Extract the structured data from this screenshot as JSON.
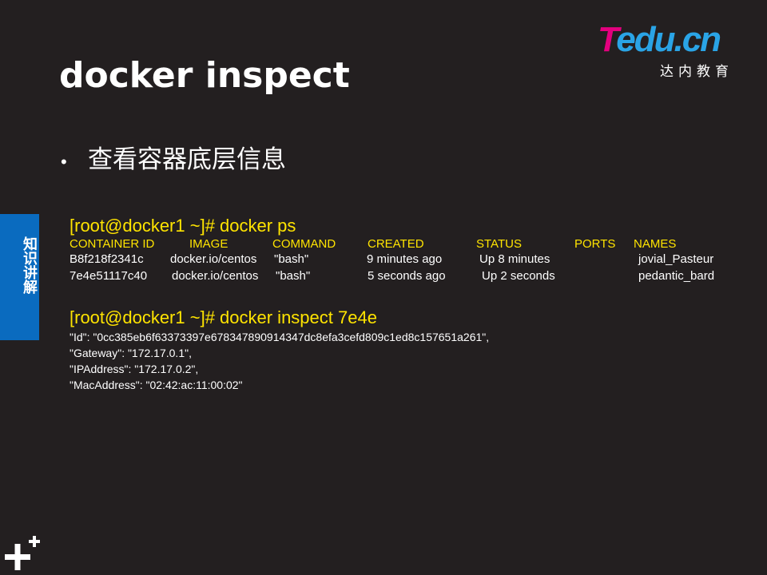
{
  "logo": {
    "word_first": "T",
    "word_rest": "edu.cn",
    "subtitle": "达内教育"
  },
  "title": "docker inspect",
  "bullet": {
    "text": "查看容器底层信息"
  },
  "side_tab": {
    "label": "知识讲解"
  },
  "terminal": {
    "cmd1": "[root@docker1 ~]# docker ps",
    "headers": [
      "CONTAINER ID",
      "IMAGE",
      "COMMAND",
      "CREATED",
      "STATUS",
      "PORTS",
      "NAMES"
    ],
    "rows": [
      [
        "B8f218f2341c",
        "docker.io/centos",
        "\"bash\"",
        "9 minutes ago",
        "Up 8 minutes",
        "",
        "jovial_Pasteur"
      ],
      [
        "7e4e51117c40",
        "docker.io/centos",
        "\"bash\"",
        "5 seconds ago",
        "Up 2 seconds",
        "",
        "pedantic_bard"
      ]
    ],
    "cmd2": "[root@docker1 ~]# docker inspect  7e4e",
    "json_lines": [
      "\"Id\": \"0cc385eb6f63373397e678347890914347dc8efa3cefd809c1ed8c157651a261\",",
      "\"Gateway\": \"172.17.0.1\",",
      "\"IPAddress\": \"172.17.0.2\",",
      "\"MacAddress\": \"02:42:ac:11:00:02\""
    ]
  },
  "colors": {
    "background": "#231f20",
    "accent_yellow": "#ffe400",
    "tab_blue": "#0a6bbf",
    "logo_pink": "#e4007f",
    "logo_blue": "#2aa4e6"
  },
  "icons": [
    "plus-icon"
  ]
}
